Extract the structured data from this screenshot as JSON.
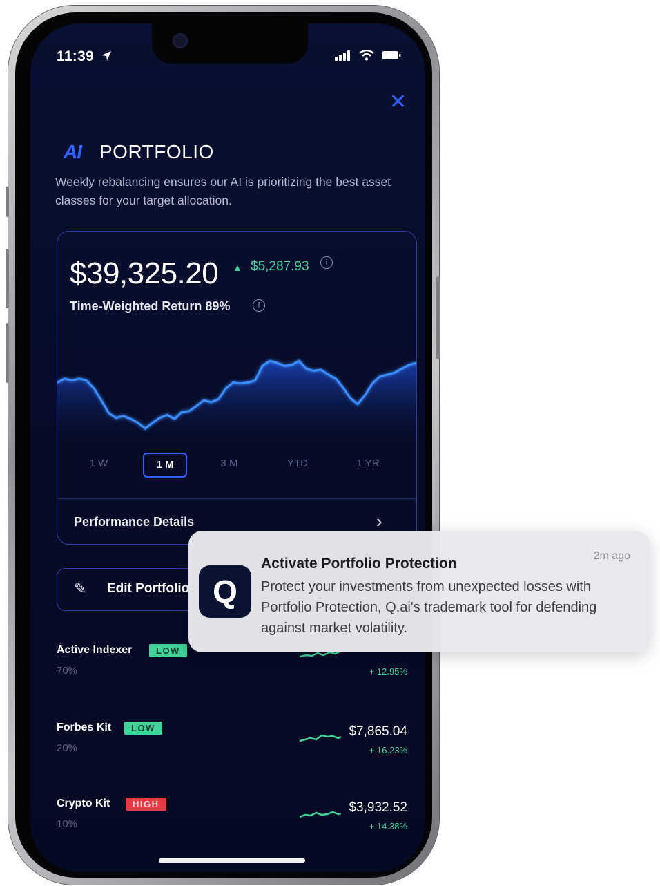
{
  "status_bar": {
    "time": "11:39"
  },
  "header": {
    "logo": "AI",
    "title": "PORTFOLIO",
    "description": "Weekly rebalancing ensures our AI is prioritizing the best asset classes for your target allocation."
  },
  "portfolio": {
    "balance": "$39,325.20",
    "change": "$5,287.93",
    "twr_label": "Time-Weighted Return 89%"
  },
  "chart_data": {
    "type": "line",
    "series": [
      {
        "values": [
          0.56,
          0.6,
          0.58,
          0.6,
          0.58,
          0.5,
          0.38,
          0.25,
          0.2,
          0.22,
          0.19,
          0.15,
          0.09,
          0.15,
          0.2,
          0.23,
          0.19,
          0.26,
          0.27,
          0.32,
          0.38,
          0.36,
          0.39,
          0.5,
          0.56,
          0.55,
          0.56,
          0.58,
          0.73,
          0.78,
          0.76,
          0.73,
          0.74,
          0.78,
          0.7,
          0.68,
          0.69,
          0.64,
          0.6,
          0.51,
          0.4,
          0.34,
          0.43,
          0.55,
          0.62,
          0.64,
          0.66,
          0.7,
          0.74,
          0.76
        ]
      }
    ],
    "accent": "#3b8dff"
  },
  "periods": [
    "1 W",
    "1 M",
    "3 M",
    "YTD",
    "1 YR"
  ],
  "active_period": "1 M",
  "performance": {
    "label": "Performance Details"
  },
  "edit": {
    "label": "Edit Portfolio"
  },
  "holdings": [
    {
      "name": "Active Indexer",
      "risk": "LOW",
      "risk_type": "low",
      "pct": "70%",
      "value": "",
      "ret": "+ 12.95%"
    },
    {
      "name": "Forbes Kit",
      "risk": "LOW",
      "risk_type": "low",
      "pct": "20%",
      "value": "$7,865.04",
      "ret": "+ 16.23%"
    },
    {
      "name": "Crypto Kit",
      "risk": "HIGH",
      "risk_type": "high",
      "pct": "10%",
      "value": "$3,932.52",
      "ret": "+ 14.38%"
    }
  ],
  "notification": {
    "title": "Activate Portfolio Protection",
    "time": "2m ago",
    "body": "Protect your investments from unexpected losses with Portfolio Protection, Q.ai's trademark tool for defending against market volatility.",
    "icon_letter": "Q"
  },
  "colors": {
    "accent": "#2f63ff",
    "positive": "#3fd49a",
    "risk_low": "#40d39a",
    "risk_high": "#e63b45",
    "background": "#060c2b"
  }
}
